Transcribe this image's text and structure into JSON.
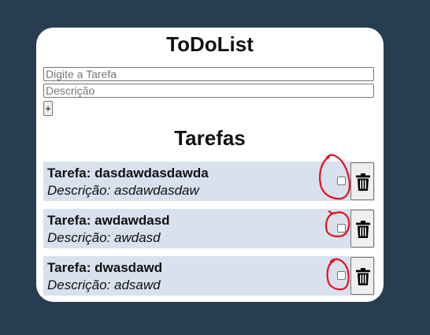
{
  "app": {
    "title": "ToDoList"
  },
  "form": {
    "task_placeholder": "Digite a Tarefa",
    "description_placeholder": "Descrição",
    "add_label": "+"
  },
  "list": {
    "title": "Tarefas",
    "items": [
      {
        "title": "Tarefa: dasdawdasdawda",
        "description": "Descrição: asdawdasdaw",
        "done": false
      },
      {
        "title": "Tarefa: awdawdasd",
        "description": "Descrição: awdasd",
        "done": false
      },
      {
        "title": "Tarefa: dwasdawd",
        "description": "Descrição: adsawd",
        "done": false
      }
    ]
  },
  "colors": {
    "background": "#293d52",
    "card": "#ffffff",
    "row": "#d9e1ee",
    "annotation": "#e0141d"
  },
  "icons": {
    "delete": "trash-icon"
  }
}
